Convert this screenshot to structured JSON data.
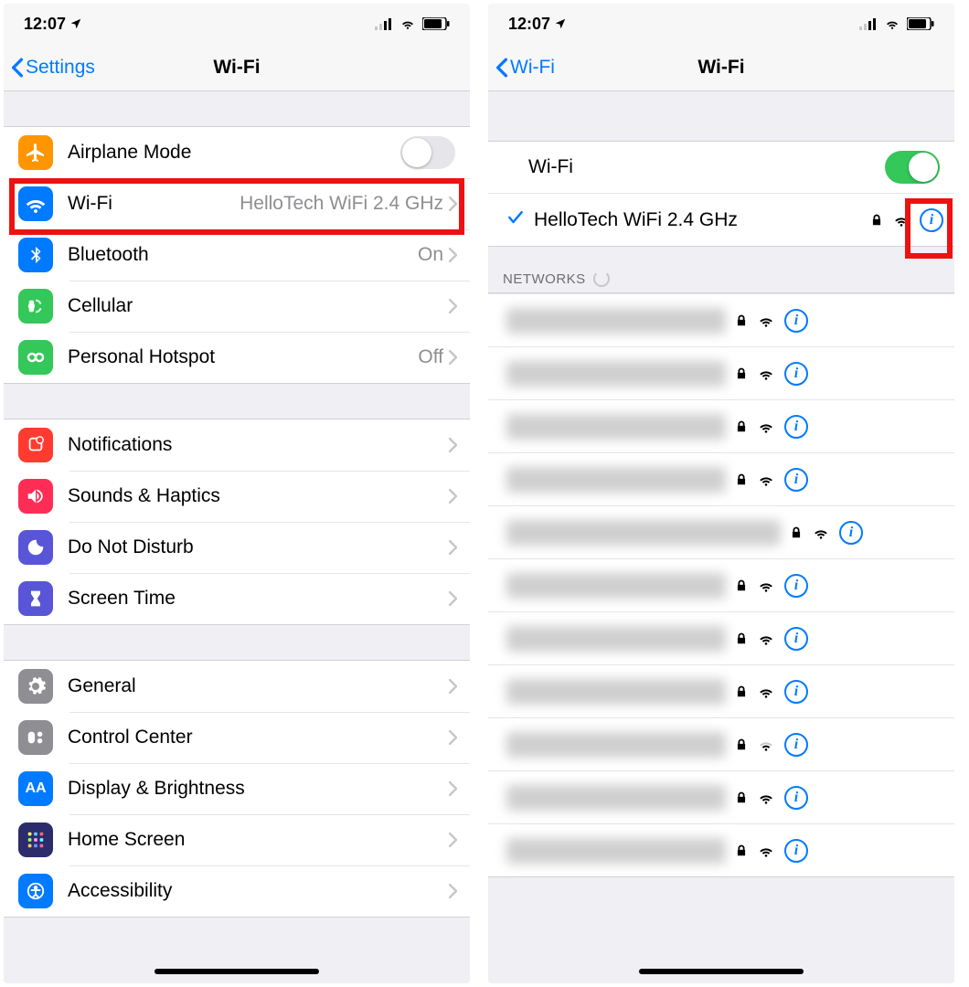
{
  "statusbar": {
    "time": "12:07"
  },
  "left": {
    "back": "Settings",
    "title": "Wi-Fi",
    "group1": {
      "airplane": "Airplane Mode",
      "wifi": "Wi-Fi",
      "wifi_detail": "HelloTech WiFi 2.4 GHz",
      "bluetooth": "Bluetooth",
      "bluetooth_detail": "On",
      "cellular": "Cellular",
      "hotspot": "Personal Hotspot",
      "hotspot_detail": "Off"
    },
    "group2": {
      "notifications": "Notifications",
      "sounds": "Sounds & Haptics",
      "dnd": "Do Not Disturb",
      "screentime": "Screen Time"
    },
    "group3": {
      "general": "General",
      "control": "Control Center",
      "display": "Display & Brightness",
      "home": "Home Screen",
      "accessibility": "Accessibility"
    }
  },
  "right": {
    "back": "Wi-Fi",
    "title": "Wi-Fi",
    "wifi_label": "Wi-Fi",
    "connected": "HelloTech WiFi 2.4 GHz",
    "networks_header": "NETWORKS"
  }
}
